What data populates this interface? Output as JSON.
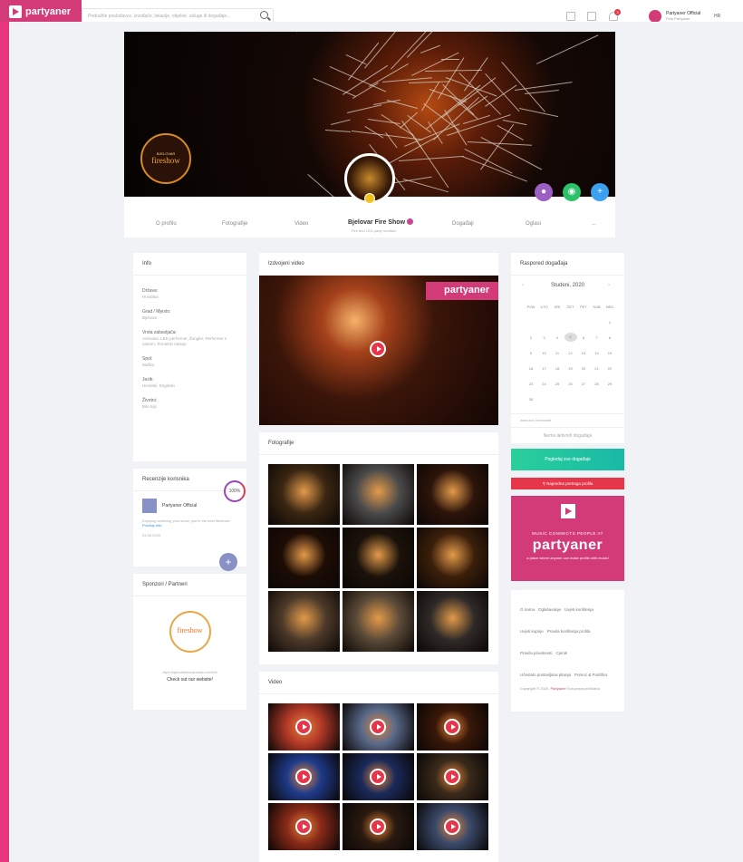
{
  "app": {
    "brand": "partyaner",
    "brand_accent": "#d23a78"
  },
  "search": {
    "placeholder": "Pretražite poslodavce, izvođače, lokacije, objekte, usluge ili događaje..."
  },
  "user": {
    "name": "Partyaner Official",
    "subtitle": "Pola Partyaner",
    "lang": "HR",
    "notifications": "3"
  },
  "profile": {
    "name": "Bjelovar Fire Show",
    "subtitle": "Fire and LED party izvođači",
    "tabs": [
      "O profilu",
      "Fotografije",
      "Video",
      "Događaji",
      "Oglasi",
      "..."
    ],
    "cover_logo": "fireshow",
    "cover_logo_small": "BJELOVAR"
  },
  "info": {
    "title": "Info",
    "rows": [
      {
        "label": "Država:",
        "value": "Hrvatska"
      },
      {
        "label": "Grad / Mjesto:",
        "value": "Bjelovar"
      },
      {
        "label": "Vrsta zabavljača:",
        "value": "Animator, LED performer, Žongler, Performer s vatrom, Tematski nastup"
      },
      {
        "label": "Spol:",
        "value": "Muško"
      },
      {
        "label": "Jezik:",
        "value": "Hrvatski, Engleski"
      },
      {
        "label": "Životni:",
        "value": "Bilo koji"
      }
    ]
  },
  "reviews": {
    "title": "Recenzije korisnika",
    "percent": "100%",
    "author": "Partyaner Official",
    "text": "Enjoying watching your show, you're the best fireshow!",
    "link": "Pročitaj više",
    "date": "25.08.2020."
  },
  "sponsors": {
    "title": "Sponzori / Partneri",
    "url": "https://bjelovarfireshow.studio.com/info",
    "cta": "Check out our website!"
  },
  "featured": {
    "title": "Izdvojeni video",
    "watermark": "partyaner"
  },
  "photos": {
    "title": "Fotografije"
  },
  "videos": {
    "title": "Video"
  },
  "calendar": {
    "title": "Raspored događaja",
    "month": "Studeni, 2020",
    "weekdays": [
      "PON",
      "UTO",
      "SRI",
      "ČET",
      "PET",
      "SUB",
      "NED"
    ],
    "link": "www.zzz.hr/novosti",
    "empty": "Nema aktivnih događaja"
  },
  "actions": {
    "all_events": "Pogledaj sve događaje",
    "search_profiles": "Napredna pretraga profila"
  },
  "promo": {
    "top": "MUSIC CONNECTS PEOPLE AT",
    "brand": "partyaner",
    "bottom": "a place where anyone can make profile with music!"
  },
  "footer": {
    "links": [
      "O nama",
      "Oglašavanje",
      "Uvjeti korištenja",
      "Uvjeti kupnje",
      "Pravila korištenja profila",
      "Pravila privatnosti",
      "Cjenik",
      "Učestalo postavljana pitanja",
      "Pomoć & Podrška"
    ],
    "copyright": "Copyright © 2020.",
    "copyright_brand": "Partyaner",
    "copyright_rest": "Sva prava pridržana"
  }
}
